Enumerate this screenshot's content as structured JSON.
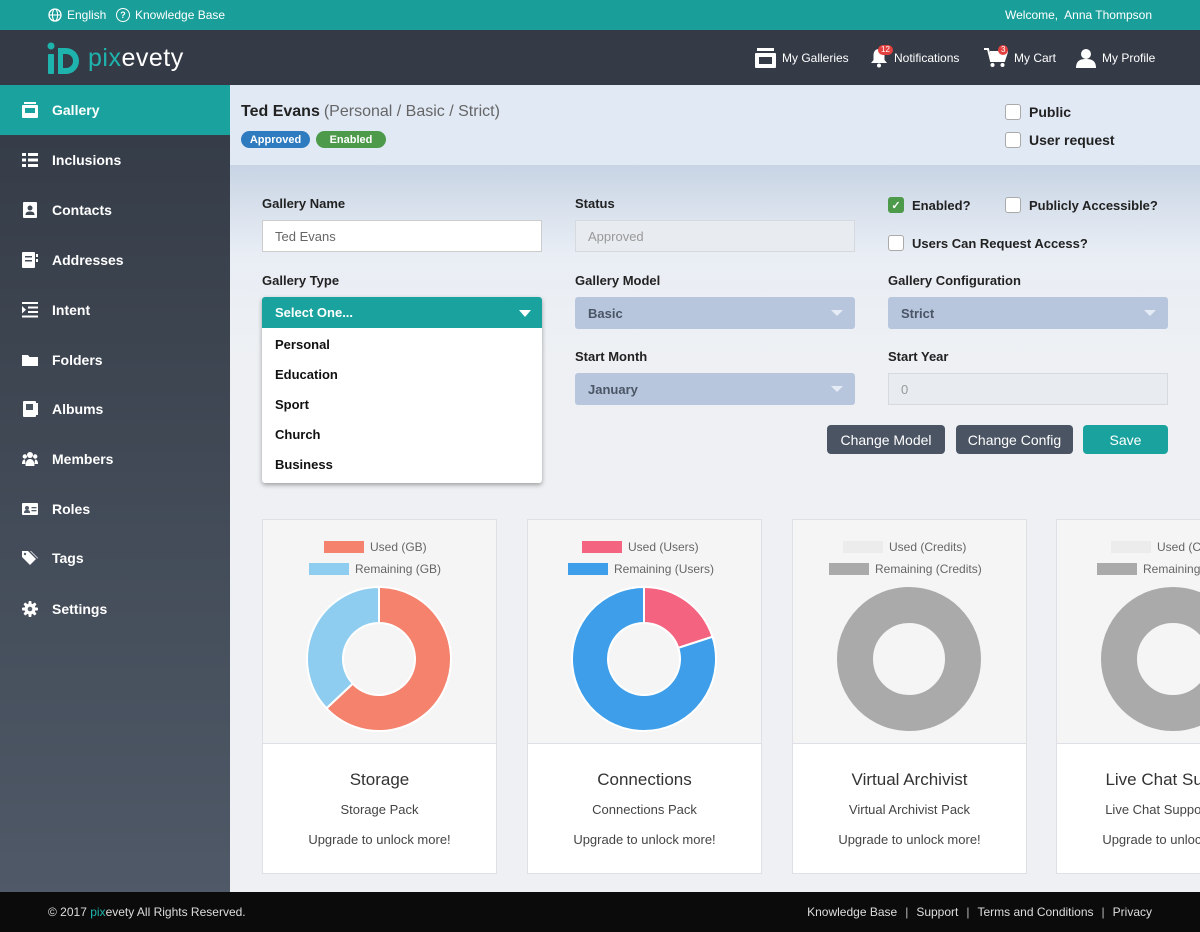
{
  "topbar": {
    "language": "English",
    "knowledge_base": "Knowledge Base",
    "welcome": "Welcome,  Anna Thompson"
  },
  "header": {
    "logo_pix": "pix",
    "logo_rest": "evety",
    "my_galleries": "My Galleries",
    "notifications": "Notifications",
    "notifications_count": "12",
    "my_cart": "My Cart",
    "cart_count": "3",
    "my_profile": "My Profile"
  },
  "sidebar": {
    "items": [
      {
        "label": "Gallery",
        "icon": "gallery-icon"
      },
      {
        "label": "Inclusions",
        "icon": "list-icon"
      },
      {
        "label": "Contacts",
        "icon": "contact-card-icon"
      },
      {
        "label": "Addresses",
        "icon": "address-book-icon"
      },
      {
        "label": "Intent",
        "icon": "indent-icon"
      },
      {
        "label": "Folders",
        "icon": "folder-icon"
      },
      {
        "label": "Albums",
        "icon": "album-icon"
      },
      {
        "label": "Members",
        "icon": "members-icon"
      },
      {
        "label": "Roles",
        "icon": "id-card-icon"
      },
      {
        "label": "Tags",
        "icon": "tags-icon"
      },
      {
        "label": "Settings",
        "icon": "gear-icon"
      }
    ]
  },
  "user": {
    "name": "Ted Evans",
    "subtitle": "(Personal / Basic / Strict)",
    "badge_approved": "Approved",
    "badge_enabled": "Enabled",
    "public_label": "Public",
    "user_request_label": "User request"
  },
  "form": {
    "gallery_name_label": "Gallery Name",
    "gallery_name_value": "Ted Evans",
    "status_label": "Status",
    "status_value": "Approved",
    "enabled_label": "Enabled?",
    "publicly_accessible_label": "Publicly Accessible?",
    "users_can_request_label": "Users Can Request Access?",
    "gallery_type_label": "Gallery Type",
    "gallery_type_value": "Select One...",
    "gallery_type_options": [
      "Personal",
      "Education",
      "Sport",
      "Church",
      "Business"
    ],
    "gallery_model_label": "Gallery Model",
    "gallery_model_value": "Basic",
    "gallery_config_label": "Gallery Configuration",
    "gallery_config_value": "Strict",
    "start_month_label": "Start Month",
    "start_month_value": "January",
    "start_year_label": "Start Year",
    "start_year_value": "0",
    "change_model_button": "Change Model",
    "change_config_button": "Change Config",
    "save_button": "Save"
  },
  "cards": [
    {
      "title": "Storage",
      "subtitle": "Storage Pack",
      "upgrade": "Upgrade to unlock more!",
      "legend_used": "Used (GB)",
      "legend_remaining": "Remaining (GB)"
    },
    {
      "title": "Connections",
      "subtitle": "Connections Pack",
      "upgrade": "Upgrade to unlock more!",
      "legend_used": "Used (Users)",
      "legend_remaining": "Remaining (Users)"
    },
    {
      "title": "Virtual Archivist",
      "subtitle": "Virtual Archivist Pack",
      "upgrade": "Upgrade to unlock more!",
      "legend_used": "Used (Credits)",
      "legend_remaining": "Remaining (Credits)"
    },
    {
      "title": "Live Chat Support",
      "subtitle": "Live Chat Support Pack",
      "upgrade": "Upgrade to unlock more!",
      "legend_used": "Used (Credits)",
      "legend_remaining": "Remaining (Credits)"
    }
  ],
  "chart_data": [
    {
      "type": "pie",
      "series": [
        {
          "name": "Used (GB)",
          "values": [
            63
          ]
        },
        {
          "name": "Remaining (GB)",
          "values": [
            37
          ]
        }
      ],
      "colors": [
        "#f4826c",
        "#8ecdef"
      ]
    },
    {
      "type": "pie",
      "series": [
        {
          "name": "Used (Users)",
          "values": [
            20
          ]
        },
        {
          "name": "Remaining (Users)",
          "values": [
            80
          ]
        }
      ],
      "colors": [
        "#f4637f",
        "#3e9ee9"
      ]
    },
    {
      "type": "pie",
      "series": [
        {
          "name": "Used (Credits)",
          "values": [
            0
          ]
        },
        {
          "name": "Remaining (Credits)",
          "values": [
            100
          ]
        }
      ],
      "colors": [
        "#ececec",
        "#aaaaaa"
      ]
    },
    {
      "type": "pie",
      "series": [
        {
          "name": "Used (Credits)",
          "values": [
            0
          ]
        },
        {
          "name": "Remaining (Credits)",
          "values": [
            100
          ]
        }
      ],
      "colors": [
        "#ececec",
        "#aaaaaa"
      ]
    }
  ],
  "colors": {
    "teal": "#1aa39e",
    "header_dark": "#343b46",
    "approved_badge": "#2e7bbf",
    "enabled_badge": "#4c9a4a",
    "button_dark": "#4a5463"
  },
  "footer": {
    "copyright_pre": "© 2017 ",
    "copyright_pix": "pix",
    "copyright_post": "evety All Rights Reserved.",
    "links": [
      "Knowledge Base",
      "Support",
      "Terms and Conditions",
      "Privacy"
    ]
  }
}
